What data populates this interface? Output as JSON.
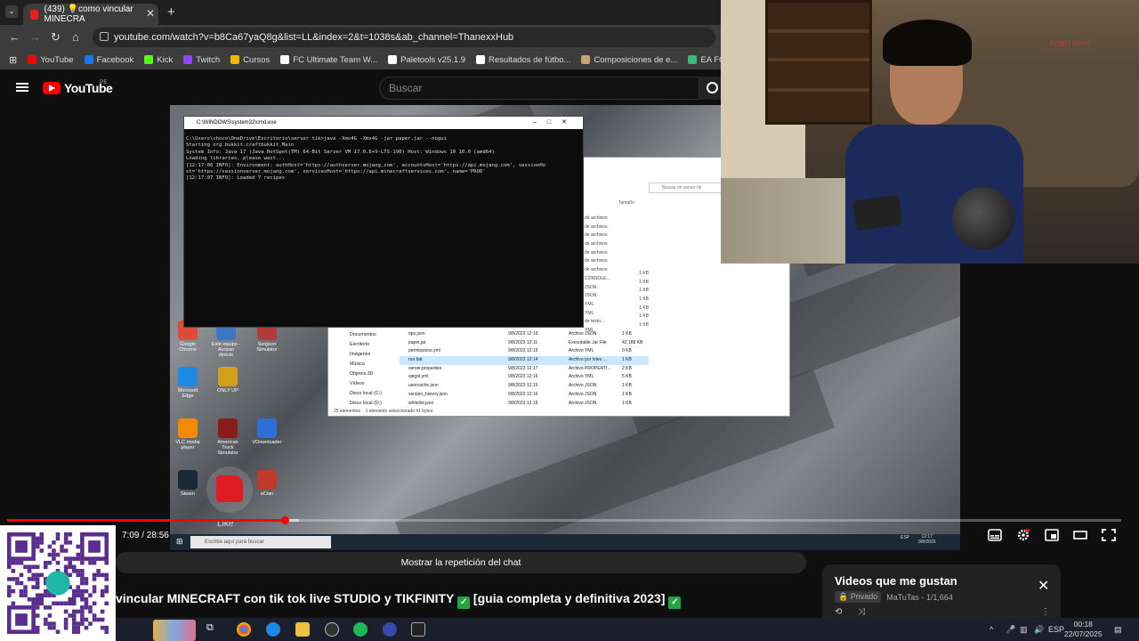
{
  "browser": {
    "tab_title": "(439) 💡como vincular MINECRA",
    "url": "youtube.com/watch?v=b8Ca67yaQ8g&list=LL&index=2&t=1038s&ab_channel=ThanexxHub",
    "bookmarks": [
      {
        "label": "YouTube",
        "color": "#ff0000"
      },
      {
        "label": "Facebook",
        "color": "#1877f2"
      },
      {
        "label": "Kick",
        "color": "#53fc18"
      },
      {
        "label": "Twitch",
        "color": "#9146ff"
      },
      {
        "label": "Cursos",
        "color": "#f4b400"
      },
      {
        "label": "FC Ultimate Team W...",
        "color": "#ffffff"
      },
      {
        "label": "Paletools v25.1.9",
        "color": "#ffffff"
      },
      {
        "label": "Resultados de fútbo...",
        "color": "#ffffff"
      },
      {
        "label": "Composiciones de e...",
        "color": "#c8a070"
      },
      {
        "label": "EA FC 24 Ultimate T...",
        "color": "#3cb878"
      },
      {
        "label": "b",
        "color": "#2ecc71"
      }
    ]
  },
  "youtube": {
    "logo_text": "YouTube",
    "country": "PE",
    "search_placeholder": "Buscar"
  },
  "cmd": {
    "title": "C:\\WINDOWS\\system32\\cmd.exe",
    "lines": "C:\\Users\\choco\\OneDrive\\Escritorio\\server tik>java -Xms4G -Xmx4G -jar paper.jar --nogui\nStarting org.bukkit.craftbukkit.Main\nSystem Info: Java 17 (Java HotSpot(TM) 64-Bit Server VM 17.0.6+9-LTS-190) Host: Windows 10 10.0 (amd64)\nLoading libraries, please wait...\n[12:17:06 INFO]: Environment: authHost='https://authserver.mojang.com', accountsHost='https://api.mojang.com', sessionHo\nst='https://sessionserver.mojang.com', servicesHost='https://api.minecraftservices.com', name='PROD'\n[12:17:07 INFO]: Loaded 7 recipes"
  },
  "explorer": {
    "search_placeholder": "Buscar en server tik",
    "size_header": "Tamaño",
    "nav": [
      "Documentos",
      "Escritorio",
      "Imágenes",
      "Música",
      "Objetos 3D",
      "Vídeos",
      "Disco local (C:)",
      "Disco local (D:)"
    ],
    "top_types": [
      "de archivos",
      "de archivos",
      "de archivos",
      "de archivos",
      "de archivos",
      "de archivos",
      "de archivos",
      "CONSOLE...",
      "JSON",
      "JSON",
      "YML",
      "YML",
      "de texto...",
      "YML"
    ],
    "top_sizes": [
      "1 KB",
      "1 KB",
      "1 KB",
      "1 KB",
      "1 KB",
      "1 KB",
      "1 KB"
    ],
    "files": [
      {
        "name": "ops.json",
        "date": "9/8/2023 12:15",
        "type": "Archivo JSON",
        "size": "1 KB"
      },
      {
        "name": "paper.jar",
        "date": "9/8/2023 12:11",
        "type": "Executable Jar File",
        "size": "42.188 KB"
      },
      {
        "name": "permissions.yml",
        "date": "9/8/2023 12:15",
        "type": "Archivo YML",
        "size": "0 KB"
      },
      {
        "name": "run.bat",
        "date": "9/8/2023 12:14",
        "type": "Archivo por lotes ...",
        "size": "1 KB"
      },
      {
        "name": "server.properties",
        "date": "9/8/2023 12:17",
        "type": "Archivo PROPERTI...",
        "size": "2 KB"
      },
      {
        "name": "spigot.yml",
        "date": "9/8/2023 12:16",
        "type": "Archivo YML",
        "size": "5 KB"
      },
      {
        "name": "usercache.json",
        "date": "9/8/2023 12:15",
        "type": "Archivo JSON",
        "size": "1 KB"
      },
      {
        "name": "version_history.json",
        "date": "9/8/2023 12:16",
        "type": "Archivo JSON",
        "size": "1 KB"
      },
      {
        "name": "whitelist.json",
        "date": "9/8/2023 12:15",
        "type": "Archivo JSON",
        "size": "1 KB"
      }
    ],
    "status_count": "25 elementos",
    "status_selected": "1 elemento seleccionado  41 bytes"
  },
  "desktop": {
    "icons": [
      {
        "label": "Google Chrome",
        "color": "#dd4b39"
      },
      {
        "label": "Este equipo - Acceso directo",
        "color": "#3a78c3"
      },
      {
        "label": "Surgeon Simulator",
        "color": "#b23a3a"
      },
      {
        "label": "Microsoft Edge",
        "color": "#1e88e5"
      },
      {
        "label": "ONLY UP",
        "color": "#d4a017"
      },
      {
        "label": "VLC media player",
        "color": "#f08a00"
      },
      {
        "label": "American Truck Simulator",
        "color": "#8b1a1a"
      },
      {
        "label": "VDownloader",
        "color": "#2d6fd6"
      },
      {
        "label": "Steam",
        "color": "#1b2838"
      },
      {
        "label": "eClan",
        "color": "#c0392b"
      }
    ],
    "taskbar_search": "Escribe aquí para buscar",
    "taskbar_time": "12:17",
    "taskbar_date": "9/8/2023",
    "taskbar_lang": "ESP"
  },
  "player": {
    "time": "7:09 / 28:56",
    "progress_fraction": 0.249,
    "like_label": "Like"
  },
  "webcam": {
    "watermark": "R3$U RP!!!"
  },
  "below": {
    "chat_replay": "Mostrar la repetición del chat",
    "title": "vincular MINECRAFT con tik tok live STUDIO y TIKFINITY",
    "title_suffix": "[guia completa y definitiva 2023]"
  },
  "playlist": {
    "title": "Videos que me gustan",
    "privacy": "Privado",
    "owner_count": "MaTuTas - 1/1,664"
  },
  "taskbar": {
    "lang": "ESP",
    "time": "00:18",
    "date": "22/07/2025"
  }
}
